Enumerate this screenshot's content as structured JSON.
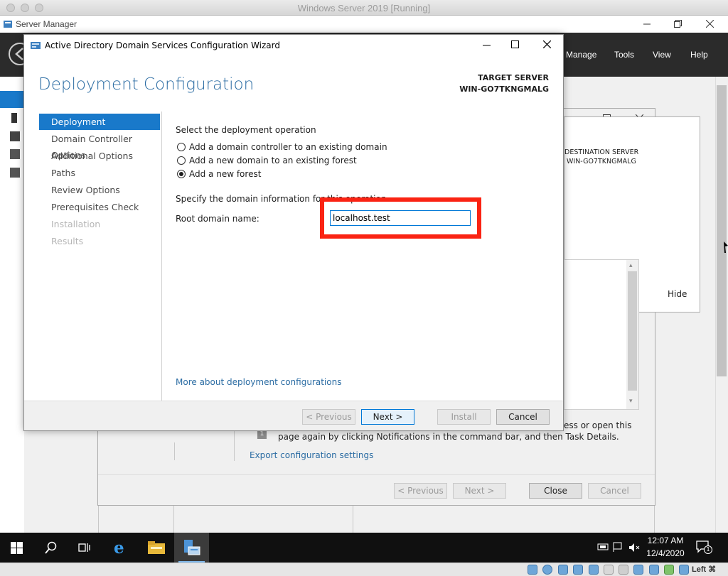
{
  "host": {
    "title": "Windows Server 2019 [Running]",
    "host_key": "Left ⌘"
  },
  "server_manager": {
    "title": "Server Manager",
    "menu": [
      "Manage",
      "Tools",
      "View",
      "Help"
    ]
  },
  "background_wizard": {
    "destination_label": "DESTINATION SERVER",
    "destination_name": "WIN-GO7TKNGMALG",
    "hide_label": "Hide",
    "notice_line1": "ess or open this",
    "notice_line2": "page again by clicking Notifications in the command bar, and then Task Details.",
    "notice_badge": "1",
    "export_link": "Export configuration settings",
    "buttons": {
      "previous": "< Previous",
      "next": "Next >",
      "close": "Close",
      "cancel": "Cancel"
    }
  },
  "wizard": {
    "title": "Active Directory Domain Services Configuration Wizard",
    "heading": "Deployment Configuration",
    "target_label": "TARGET SERVER",
    "target_name": "WIN-GO7TKNGMALG",
    "nav": [
      {
        "label": "Deployment Configuration",
        "state": "active"
      },
      {
        "label": "Domain Controller Options",
        "state": "enabled"
      },
      {
        "label": "Additional Options",
        "state": "enabled"
      },
      {
        "label": "Paths",
        "state": "enabled"
      },
      {
        "label": "Review Options",
        "state": "enabled"
      },
      {
        "label": "Prerequisites Check",
        "state": "enabled"
      },
      {
        "label": "Installation",
        "state": "disabled"
      },
      {
        "label": "Results",
        "state": "disabled"
      }
    ],
    "select_operation_label": "Select the deployment operation",
    "options": [
      {
        "label": "Add a domain controller to an existing domain",
        "checked": false
      },
      {
        "label": "Add a new domain to an existing forest",
        "checked": false
      },
      {
        "label": "Add a new forest",
        "checked": true
      }
    ],
    "domain_info_label": "Specify the domain information for this operation",
    "root_domain_label": "Root domain name:",
    "root_domain_value": "localhost.test",
    "more_link": "More about deployment configurations",
    "buttons": {
      "previous": "< Previous",
      "next": "Next >",
      "install": "Install",
      "cancel": "Cancel"
    }
  },
  "taskbar": {
    "time": "12:07 AM",
    "date": "12/4/2020",
    "notification_count": "1"
  },
  "colors": {
    "accent": "#0078d7",
    "nav_active": "#1979ca",
    "heading": "#2b6ca3",
    "highlight": "#fa2313"
  }
}
